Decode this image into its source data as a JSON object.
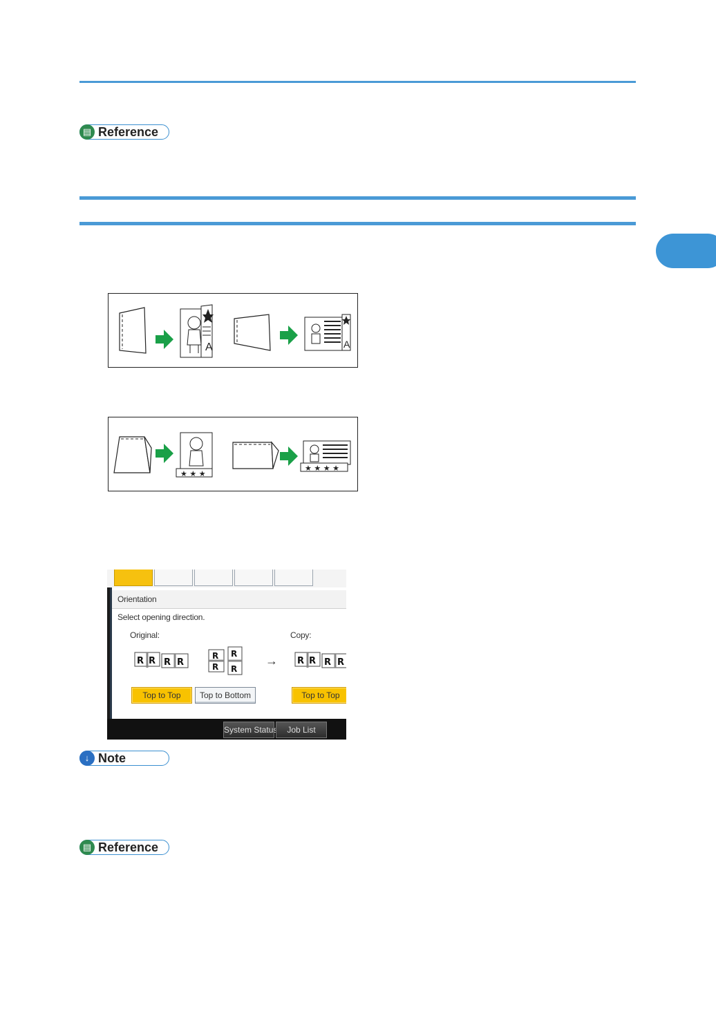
{
  "page": {
    "chapter_tab_color": "#3d95d6",
    "rule_color": "#4a9ad6"
  },
  "labels": {
    "reference_top": "Reference",
    "note": "Note",
    "reference_bottom": "Reference"
  },
  "panel": {
    "section_title": "Orientation",
    "instruction": "Select opening direction.",
    "original_label": "Original:",
    "copy_label": "Copy:",
    "arrow_glyph": "→",
    "original_buttons": [
      "Top to Top",
      "Top to Bottom"
    ],
    "copy_buttons": [
      "Top to Top"
    ],
    "selected_color": "#f8c200",
    "footer": {
      "system_status": "System Status",
      "job_list": "Job List"
    }
  }
}
